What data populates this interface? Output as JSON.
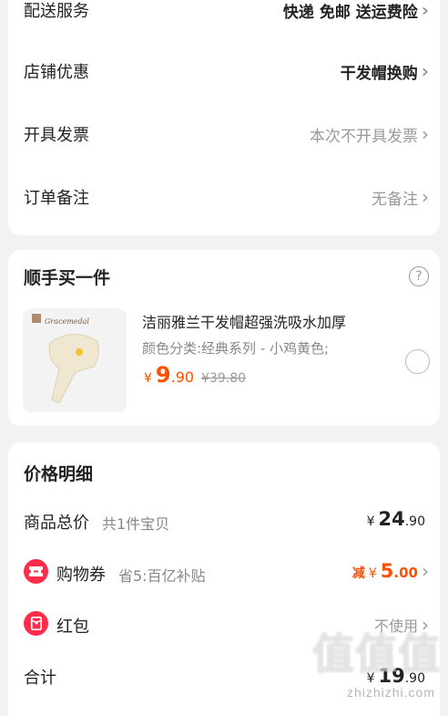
{
  "order_card": {
    "rows": [
      {
        "label": "配送服务",
        "value": "快递 免邮 送运费险"
      },
      {
        "label": "店铺优惠",
        "value": "干发帽换购"
      },
      {
        "label": "开具发票",
        "value": "本次不开具发票"
      },
      {
        "label": "订单备注",
        "value": "无备注"
      }
    ]
  },
  "addon": {
    "title": "顺手买一件",
    "help_icon": "question-circle-icon",
    "product": {
      "brand_text": "Gracemedal",
      "name": "洁丽雅兰干发帽超强洗吸水加厚",
      "variant": "颜色分类:经典系列 - 小鸡黄色;",
      "currency": "¥",
      "price_int": "9",
      "price_dec": ".90",
      "orig_price": "¥39.80"
    }
  },
  "price_detail": {
    "title": "价格明细",
    "total_label": "商品总价",
    "total_sub": "共1件宝贝",
    "total_currency": "¥",
    "total_int": "24",
    "total_dec": ".90",
    "coupon_label": "购物券",
    "coupon_sub": "省5:百亿补贴",
    "coupon_prefix": "减",
    "coupon_currency": "¥",
    "coupon_int": "5",
    "coupon_dec": ".00",
    "redpack_label": "红包",
    "redpack_value": "不使用",
    "sum_label": "合计",
    "sum_currency": "¥",
    "sum_int": "19",
    "sum_dec": ".90"
  },
  "watermark": {
    "main": "值值值",
    "sub": "zhizhizhi.com"
  },
  "colors": {
    "accent": "#ff5000",
    "icon_red": "#ff2d4a"
  }
}
